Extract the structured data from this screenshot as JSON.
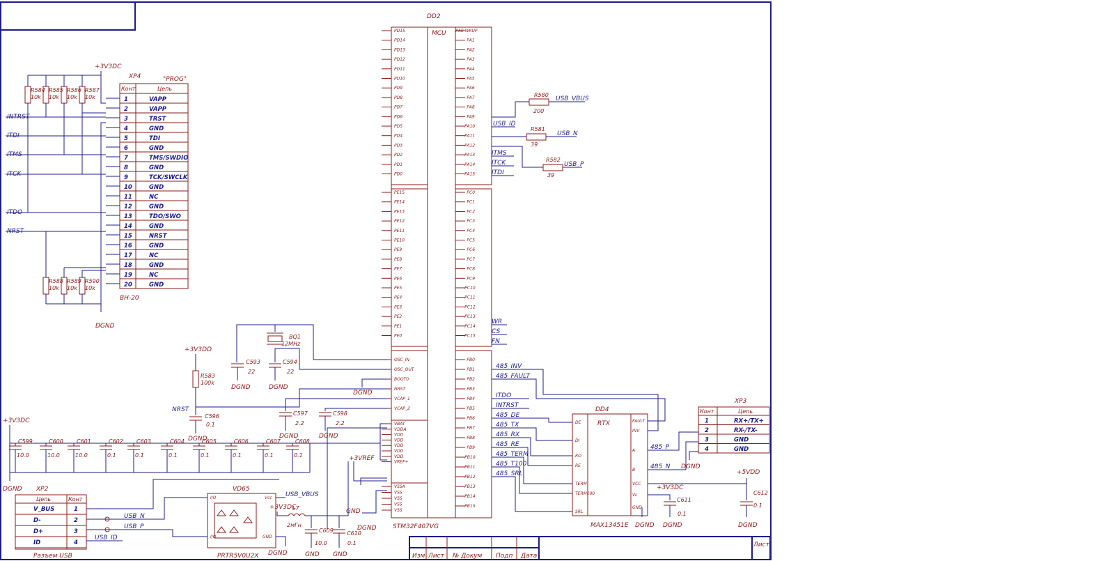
{
  "mcu": {
    "designator": "DD2",
    "title": "MCU",
    "part": "STM32F407VG",
    "left_pins_d": [
      "PD15",
      "PD14",
      "PD13",
      "PD12",
      "PD11",
      "PD10",
      "PD9",
      "PD8",
      "PD7",
      "PD6",
      "PD5",
      "PD4",
      "PD3",
      "PD2",
      "PD1",
      "PD0"
    ],
    "left_pins_e": [
      "PE15",
      "PE14",
      "PE13",
      "PE12",
      "PE11",
      "PE10",
      "PE9",
      "PE8",
      "PE7",
      "PE6",
      "PE5",
      "PE4",
      "PE3",
      "PE2",
      "PE1",
      "PE0"
    ],
    "left_pins_sys": [
      "OSC_IN",
      "OSC_OUT",
      "BOOT0",
      "NRST",
      "VCAP_1",
      "VCAP_2"
    ],
    "left_pins_pwr": [
      "VBAT",
      "VDDA",
      "VDD",
      "VDD",
      "VDD",
      "VDD",
      "VDD",
      "VREF+"
    ],
    "left_pins_gnd": [
      "VSSA",
      "VSS",
      "VSS",
      "VSS",
      "VSS"
    ],
    "right_pins_a": [
      "PA0-WKUP",
      "PA1",
      "PA2",
      "PA3",
      "PA4",
      "PA5",
      "PA6",
      "PA7",
      "PA8",
      "PA9",
      "PA10",
      "PA11",
      "PA12",
      "PA13",
      "PA14",
      "PA15"
    ],
    "right_pins_c": [
      "PC0",
      "PC1",
      "PC2",
      "PC3",
      "PC4",
      "PC5",
      "PC6",
      "PC7",
      "PC8",
      "PC9",
      "PC10",
      "PC11",
      "PC12",
      "PC13",
      "PC14",
      "PC15"
    ],
    "right_pins_b": [
      "PB0",
      "PB1",
      "PB2",
      "PB3",
      "PB4",
      "PB5",
      "PB6",
      "PB7",
      "PB8",
      "PB9",
      "PB10",
      "PB11",
      "PB12",
      "PB13",
      "PB14",
      "PB15"
    ]
  },
  "mcu_nets": {
    "pa": {
      "PA9": "USB_VBUS",
      "PA10": "USB_ID",
      "PA11": "USB_N",
      "PA12": "USB_P",
      "PA13": "ITMS",
      "PA14": "ITCK",
      "PA15": "ITDI"
    },
    "pc": {
      "PC13": "WR",
      "PC14": "CS",
      "PC15": "FN"
    },
    "pb": {
      "PB0": "485_INV",
      "PB1": "485_FAULT",
      "PB3": "ITDO",
      "PB4": "INTRST",
      "PB5": "485_DE",
      "PB6": "485_TX",
      "PB7": "485_RX",
      "PB8": "485_RE",
      "PB9": "485_TERM",
      "PB10": "485_T100",
      "PB11": "485_SRL"
    }
  },
  "usb_resistors": [
    {
      "ref": "R580",
      "value": "200"
    },
    {
      "ref": "R581",
      "value": "39"
    },
    {
      "ref": "R582",
      "value": "39"
    }
  ],
  "prog_connector": {
    "designator": "XP4",
    "title": "\"PROG\"",
    "col_pin": "Конт",
    "col_net": "Цепь",
    "part": "BH-20",
    "rows": [
      [
        "1",
        "VAPP"
      ],
      [
        "2",
        "VAPP"
      ],
      [
        "3",
        "TRST"
      ],
      [
        "4",
        "GND"
      ],
      [
        "5",
        "TDI"
      ],
      [
        "6",
        "GND"
      ],
      [
        "7",
        "TMS/SWDIO"
      ],
      [
        "8",
        "GND"
      ],
      [
        "9",
        "TCK/SWCLK"
      ],
      [
        "10",
        "GND"
      ],
      [
        "11",
        "NC"
      ],
      [
        "12",
        "GND"
      ],
      [
        "13",
        "TDO/SWO"
      ],
      [
        "14",
        "GND"
      ],
      [
        "15",
        "NRST"
      ],
      [
        "16",
        "GND"
      ],
      [
        "17",
        "NC"
      ],
      [
        "18",
        "GND"
      ],
      [
        "19",
        "NC"
      ],
      [
        "20",
        "GND"
      ]
    ],
    "left_nets": [
      "INTRST",
      "ITDI",
      "ITMS",
      "ITCK",
      "ITDO",
      "NRST"
    ],
    "pullups": [
      {
        "ref": "R584",
        "value": "10k"
      },
      {
        "ref": "R585",
        "value": "10k"
      },
      {
        "ref": "R586",
        "value": "10k"
      },
      {
        "ref": "R587",
        "value": "10k"
      }
    ],
    "pulldowns": [
      {
        "ref": "R588",
        "value": "10k"
      },
      {
        "ref": "R589",
        "value": "10k"
      },
      {
        "ref": "R590",
        "value": "10k"
      }
    ],
    "supply": "+3V3DC",
    "ground": "DGND"
  },
  "crystal": {
    "ref": "BQ1",
    "value": "12MHz"
  },
  "osc_caps": [
    {
      "ref": "C593",
      "value": "22"
    },
    {
      "ref": "C594",
      "value": "22"
    }
  ],
  "reset": {
    "supply": "+3V3DD",
    "ref": "R583",
    "value": "100k",
    "net": "NRST",
    "cap_ref": "C596",
    "cap_value": "0.1"
  },
  "vcap": [
    {
      "ref": "C597",
      "value": "2.2"
    },
    {
      "ref": "C598",
      "value": "2.2"
    }
  ],
  "decoupling": {
    "supply": "+3V3DC",
    "caps": [
      {
        "ref": "C599",
        "value": "10.0"
      },
      {
        "ref": "C600",
        "value": "10.0"
      },
      {
        "ref": "C601",
        "value": "10.0"
      },
      {
        "ref": "C602",
        "value": "0.1"
      },
      {
        "ref": "C603",
        "value": "0.1"
      },
      {
        "ref": "C604",
        "value": "0.1"
      },
      {
        "ref": "C605",
        "value": "0.1"
      },
      {
        "ref": "C606",
        "value": "0.1"
      },
      {
        "ref": "C607",
        "value": "0.1"
      },
      {
        "ref": "C608",
        "value": "0.1"
      }
    ]
  },
  "vref": "+3VREF",
  "usb_connector": {
    "designator": "XP2",
    "col_net": "Цепь",
    "col_pin": "Конт",
    "rows": [
      [
        "V_BUS",
        "1"
      ],
      [
        "D-",
        "2"
      ],
      [
        "D+",
        "3"
      ],
      [
        "ID",
        "4"
      ]
    ],
    "caption": "Разъем USB",
    "nets": [
      "USB_N",
      "USB_P",
      "USB_ID"
    ]
  },
  "esd": {
    "ref": "VD65",
    "part": "PRTR5V0U2X",
    "net": "USB_VBUS",
    "pins": [
      "I/O",
      "I/O",
      "Vcc",
      "GND"
    ]
  },
  "vref_filter": {
    "supply": "+3V3DC",
    "inductor": {
      "ref": "L7",
      "value": "2мГн"
    },
    "caps": [
      {
        "ref": "C609",
        "value": "10.0"
      },
      {
        "ref": "C610",
        "value": "0.1"
      }
    ]
  },
  "transceiver": {
    "designator": "DD4",
    "title": "RTX",
    "part": "MAX13451E",
    "left_pins": [
      "DE",
      "DI",
      "RO",
      "RE",
      "TERM",
      "TERM100",
      "SRL"
    ],
    "right_pins": [
      "FAULT",
      "INV",
      "A",
      "B",
      "VCC",
      "VL",
      "GND"
    ],
    "nets": [
      "485_P",
      "485_N"
    ],
    "vl_supply": "+3V3DC",
    "vl_cap": {
      "ref": "C611",
      "value": "0.1"
    },
    "vcc_supply": "+5VDD",
    "vcc_cap": {
      "ref": "C612",
      "value": "0.1"
    }
  },
  "rs485_connector": {
    "designator": "XP3",
    "col_pin": "Конт",
    "col_net": "Цепь",
    "rows": [
      [
        "1",
        "RX+/TX+"
      ],
      [
        "2",
        "RX-/TX-"
      ],
      [
        "3",
        "GND"
      ],
      [
        "4",
        "GND"
      ]
    ]
  },
  "ground_label": "DGND",
  "gnd_label": "GND",
  "title_block": {
    "cols": [
      "Изм",
      "Лист",
      "№ Докум",
      "Подп",
      "Дата"
    ],
    "sheet_label": "Лист"
  },
  "colors": {
    "line": "#1c1c8c",
    "component": "#8b1a1a",
    "background": "#ffffff"
  }
}
